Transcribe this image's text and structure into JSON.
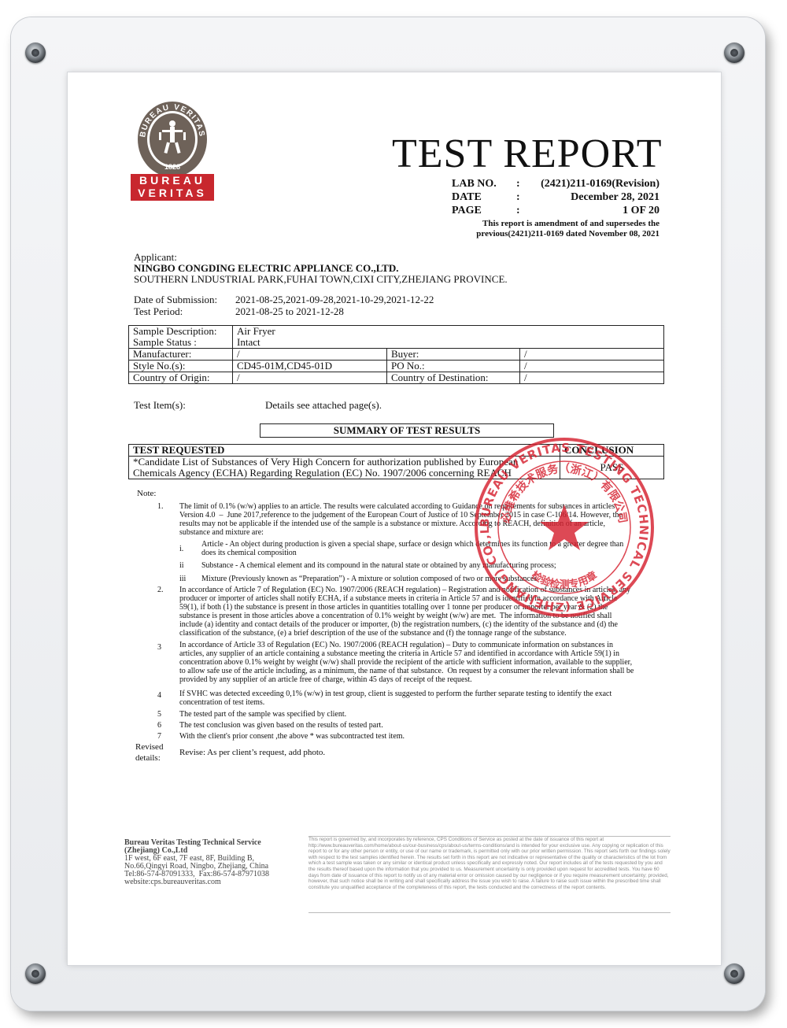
{
  "logo": {
    "arc_text": "BUREAU VERITAS",
    "year": "1828",
    "banner_top": "BUREAU",
    "banner_bottom": "VERITAS",
    "colors": {
      "brown": "#6e6259",
      "red": "#c8272e"
    }
  },
  "header": {
    "title": "TEST REPORT",
    "lab_no_label": "LAB NO.",
    "lab_no": "(2421)211-0169(Revision)",
    "date_label": "DATE",
    "date": "December 28, 2021",
    "page_label": "PAGE",
    "page": "1 OF 20",
    "colon": ":",
    "amend_line1": "This report is amendment of and supersedes the",
    "amend_line2": "previous(2421)211-0169 dated November 08, 2021"
  },
  "applicant": {
    "label": "Applicant:",
    "name": "NINGBO CONGDING ELECTRIC APPLIANCE CO.,LTD.",
    "address": "SOUTHERN LNDUSTRIAL PARK,FUHAI TOWN,CIXI CITY,ZHEJIANG PROVINCE."
  },
  "dates": {
    "submission_label": "Date of Submission:",
    "submission": "2021-08-25,2021-09-28,2021-10-29,2021-12-22",
    "period_label": "Test Period:",
    "period": "2021-08-25 to 2021-12-28"
  },
  "sample": {
    "description_label": "Sample Description:",
    "description": "Air Fryer",
    "status_label": "Sample Status :",
    "status": "Intact",
    "manufacturer_label": "Manufacturer:",
    "manufacturer": "/",
    "buyer_label": "Buyer:",
    "buyer": "/",
    "style_label": "Style No.(s):",
    "style": "CD45-01M,CD45-01D",
    "po_label": "PO No.:",
    "po": "/",
    "origin_label": "Country of Origin:",
    "origin": "/",
    "destination_label": "Country of Destination:",
    "destination": "/"
  },
  "test_item": {
    "label": "Test Item(s):",
    "value": "Details see attached page(s)."
  },
  "summary": {
    "title": "SUMMARY OF TEST RESULTS",
    "col_requested": "TEST REQUESTED",
    "col_conclusion": "CONCLUSION",
    "row_text_1": "*Candidate List of Substances of Very High Concern for authorization published by European",
    "row_text_2": "Chemicals Agency (ECHA) Regarding Regulation (EC) No. 1907/2006 concerning REACH",
    "conclusion": "PASS"
  },
  "notes": {
    "label": "Note:",
    "n1_num": "1.",
    "n1_l1": "The limit of 0.1% (w/w) applies to an article. The results were calculated according to Guidance on requirements for substances in articles",
    "n1_l2": "Version 4.0  –  June 2017,reference to the judgement of the European Court of Justice of 10 September 2015 in case C-106/14. However, the",
    "n1_l3": "results may not be applicable if the intended use of the sample is a substance or mixture. According to REACH, definition of an article,",
    "n1_l4": "substance and mixture are:",
    "n1_i_num": "i.",
    "n1_i_l1": "Article - An object during production is given a special shape, surface or design which determines its function to a greater degree than",
    "n1_i_l2": "does its chemical composition",
    "n1_ii_num": "ii",
    "n1_ii": "Substance - A chemical element and its compound in the natural state or obtained by any manufacturing process;",
    "n1_iii_num": "iii",
    "n1_iii": "Mixture (Previously known as “Preparation”) - A mixture or solution composed of two or more substances",
    "n2_num": "2.",
    "n2_l1": "In accordance of Article 7 of Regulation (EC) No. 1907/2006 (REACH regulation) – Registration and notification of substances in articles, any",
    "n2_l2": "producer or importer of articles shall notify ECHA, if a substance meets in criteria in Article 57 and is identified in accordance with Article",
    "n2_l3": "59(1), if both (1) the substance is present in those articles in quantities totalling over 1 tonne per producer or importer per year & (2) the",
    "n2_l4": "substance is present in those articles above a concentration of 0.1% weight by weight (w/w) are met.  The information to be notified shall",
    "n2_l5": "include (a) identity and contact details of the producer or importer, (b) the registration numbers, (c) the identity of the substance and (d) the",
    "n2_l6": "classification of the substance, (e) a brief description of the use of the substance and (f) the tonnage range of the substance.",
    "n3_num": "3",
    "n3_l1": "In accordance of Article 33 of Regulation (EC) No. 1907/2006 (REACH regulation) – Duty to communicate information on substances in",
    "n3_l2": "articles, any supplier of an article containing a substance meeting the criteria in Article 57 and identified in accordance with Article 59(1) in",
    "n3_l3": "concentration above 0.1% weight by weight (w/w) shall provide the recipient of the article with sufficient information, available to the supplier,",
    "n3_l4": "to allow safe use of the article including, as a minimum, the name of that substance.  On request by a consumer the relevant information shall be",
    "n3_l5": "provided by any supplier of an article free of charge, within 45 days of receipt of the request.",
    "n4_num": "4",
    "n4_l1": "If SVHC was detected exceeding 0,1% (w/w) in test group, client is suggested to perform the further separate testing to identify the exact",
    "n4_l2": "concentration of test items.",
    "n5_num": "5",
    "n5": "The tested part of the sample was specified by client.",
    "n6_num": "6",
    "n6": "The test conclusion was given based on the results of tested part.",
    "n7_num": "7",
    "n7": "With the client's prior consent ,the above * was subcontracted test item.",
    "revised_label_1": "Revised",
    "revised_label_2": "details:",
    "revised": "Revise: As per client’s request, add photo."
  },
  "stamp": {
    "outer_text": "BUREAU VERITAS TESTING TECHNICAL SERVICE (ZHEJIANG) CO.,LTD.",
    "inner_top": "必维希技术服务（浙江）有限公司",
    "inner_bottom": "检验检测专用章",
    "color": "#d62230"
  },
  "footer": {
    "company_1": "Bureau Veritas Testing Technical Service",
    "company_2": "(Zhejiang) Co.,Ltd",
    "addr_1": "1F west, 6F east, 7F east, 8F, Building B,",
    "addr_2": "No.66,Qingyi Road, Ningbo, Zhejiang, China",
    "tel": "Tel:86-574-87091333,  Fax:86-574-87971038",
    "web": "website:cps.bureauveritas.com",
    "disclaimer": "This report is governed by, and incorporates by reference, CPS Conditions of Service as posted at the date of issuance of this report at http://www.bureauveritas.com/home/about-us/our-business/cps/about-us/terms-conditions/and is intended for your exclusive use. Any copying or replication of this report to or for any other person or entity, or use of our name or trademark, is permitted only with our prior written permission. This report sets forth our findings solely with respect to the test samples identified herein. The results set forth in this report are not indicative or representative of the quality or characteristics of the lot from which a test sample was taken or any similar or identical product unless specifically and expressly noted. Our report includes all of the tests requested by you and the results thereof based upon the information that you provided to us. Measurement uncertainty is only provided upon request for accredited tests. You have 60 days from date of issuance of this report to notify us of any material error or omission caused by our negligence or if you require measurement uncertainty; provided, however, that such notice shall be in writing and shall specifically address the issue you wish to raise. A failure to raise such issue within the prescribed time shall constitute you unqualified acceptance of the completeness of this report, the tests conducted and the correctness of the report contents."
  }
}
